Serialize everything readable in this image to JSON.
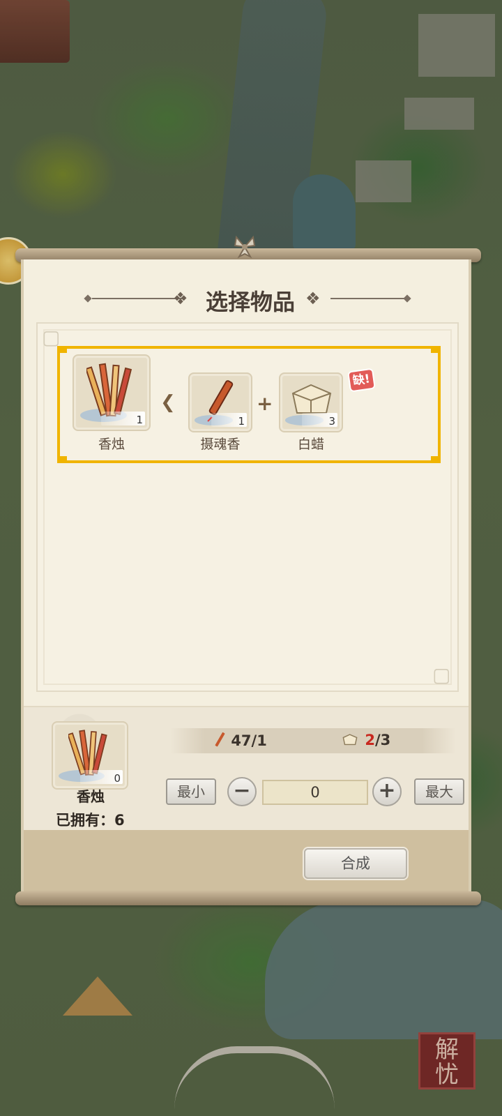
{
  "dialog": {
    "title": "选择物品",
    "recipe": {
      "result": {
        "name": "香烛",
        "count": "1"
      },
      "ingredients": [
        {
          "name": "摄魂香",
          "count": "1"
        },
        {
          "name": "白蜡",
          "count": "3",
          "badge": "缺!"
        }
      ]
    },
    "selected": {
      "name": "香烛",
      "count": "0",
      "owned_label": "已拥有：",
      "owned_value": "6"
    },
    "requirements": [
      {
        "icon": "incense-icon",
        "have": "47",
        "need": "/1"
      },
      {
        "icon": "white-wax-icon",
        "have": "2",
        "need": "/3",
        "insufficient": true
      }
    ],
    "quantity": {
      "min_label": "最小",
      "max_label": "最大",
      "value": "0"
    },
    "compose_label": "合成"
  },
  "corner_seal": "解\n忧",
  "colors": {
    "highlight": "#f0b400",
    "insufficient": "#c8281f",
    "lack_badge": "#e25b58"
  }
}
